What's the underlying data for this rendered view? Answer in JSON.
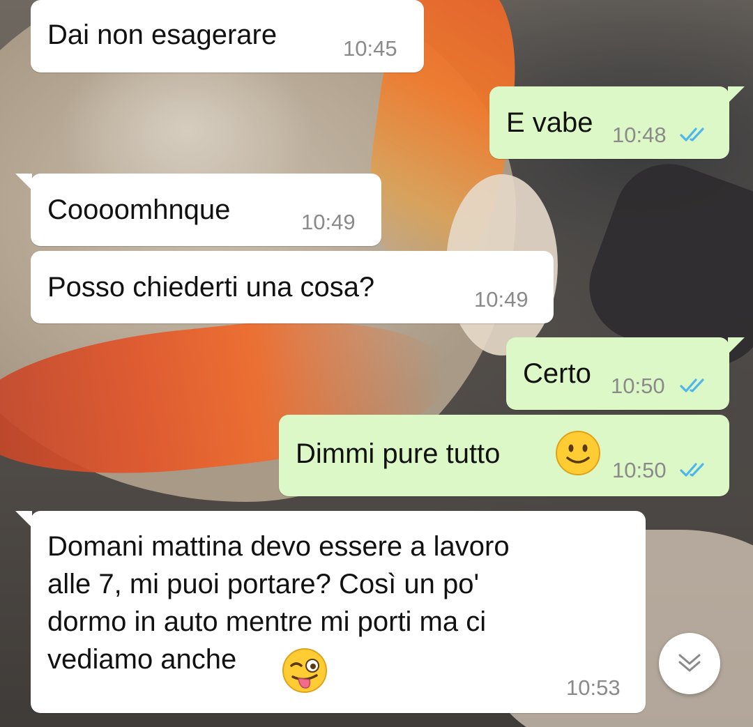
{
  "messages": [
    {
      "direction": "incoming",
      "text": "Dai non esagerare",
      "time": "10:45"
    },
    {
      "direction": "outgoing",
      "text": "E vabe",
      "time": "10:48",
      "status": "read"
    },
    {
      "direction": "incoming",
      "text": "Coooomhnque",
      "time": "10:49"
    },
    {
      "direction": "incoming",
      "text": "Posso chiederti una cosa?",
      "time": "10:49"
    },
    {
      "direction": "outgoing",
      "text": "Certo",
      "time": "10:50",
      "status": "read"
    },
    {
      "direction": "outgoing",
      "text": "Dimmi pure tutto",
      "emoji": "slightly-smiling-face",
      "time": "10:50",
      "status": "read"
    },
    {
      "direction": "incoming",
      "lines": [
        "Domani mattina devo essere a lavoro",
        "alle 7, mi puoi portare? Così un po'",
        "dormo in auto mentre mi porti ma ci",
        "vediamo anche"
      ],
      "emoji": "winking-face-with-tongue",
      "time": "10:53"
    }
  ],
  "controls": {
    "scroll_down_icon": "double-chevron-down-icon"
  },
  "colors": {
    "incoming_bubble": "#ffffff",
    "outgoing_bubble": "#dcf8c6",
    "timestamp": "#8a8a8a",
    "read_ticks": "#4fb6ec"
  }
}
